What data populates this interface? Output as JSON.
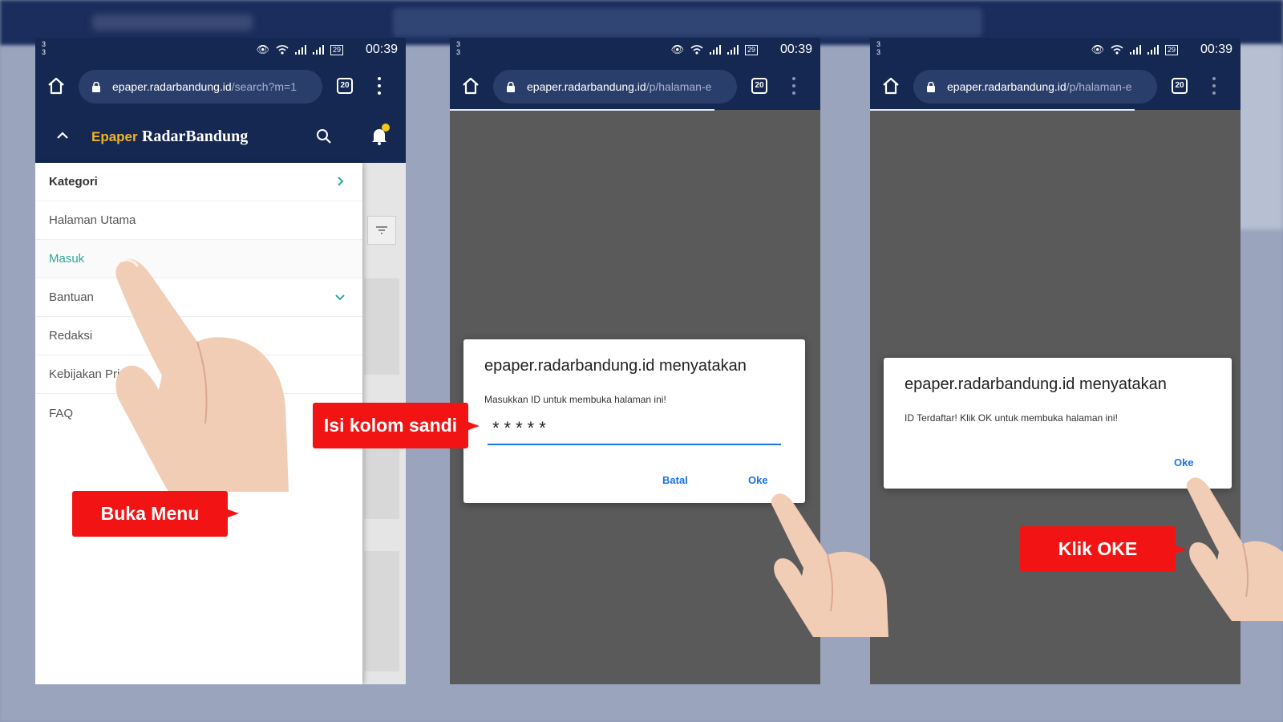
{
  "status_bar": {
    "sim": "3 3",
    "battery": "29",
    "time": "00:39"
  },
  "browser": {
    "tab_count": "20",
    "phone1_url_host": "epaper.radarbandung.id",
    "phone1_url_path": "/search?m=1",
    "phone2_url_host": "epaper.radarbandung.id",
    "phone2_url_path": "/p/halaman-e",
    "phone3_url_host": "epaper.radarbandung.id",
    "phone3_url_path": "/p/halaman-e"
  },
  "site": {
    "brand_epaper": "Epaper",
    "brand_name": "RadarBandung"
  },
  "drawer": {
    "items": [
      {
        "label": "Kategori"
      },
      {
        "label": "Halaman Utama"
      },
      {
        "label": "Masuk"
      },
      {
        "label": "Bantuan"
      },
      {
        "label": "Redaksi"
      },
      {
        "label": "Kebijakan Privasi"
      },
      {
        "label": "FAQ"
      }
    ]
  },
  "dialog_password": {
    "title": "epaper.radarbandung.id menyatakan",
    "message": "Masukkan ID untuk membuka halaman ini!",
    "value": "*****",
    "cancel_label": "Batal",
    "ok_label": "Oke"
  },
  "dialog_registered": {
    "title": "epaper.radarbandung.id menyatakan",
    "message": "ID Terdaftar! Klik OK untuk membuka halaman ini!",
    "ok_label": "Oke"
  },
  "callouts": {
    "open_menu": "Buka Menu",
    "fill_password": "Isi kolom sandi",
    "click_ok": "Klik OKE"
  },
  "colors": {
    "navbar": "#142852",
    "callout": "#f21414",
    "accent_teal": "#2ba89a",
    "link_blue": "#1a73e8",
    "brand_gold": "#f0b42a"
  }
}
